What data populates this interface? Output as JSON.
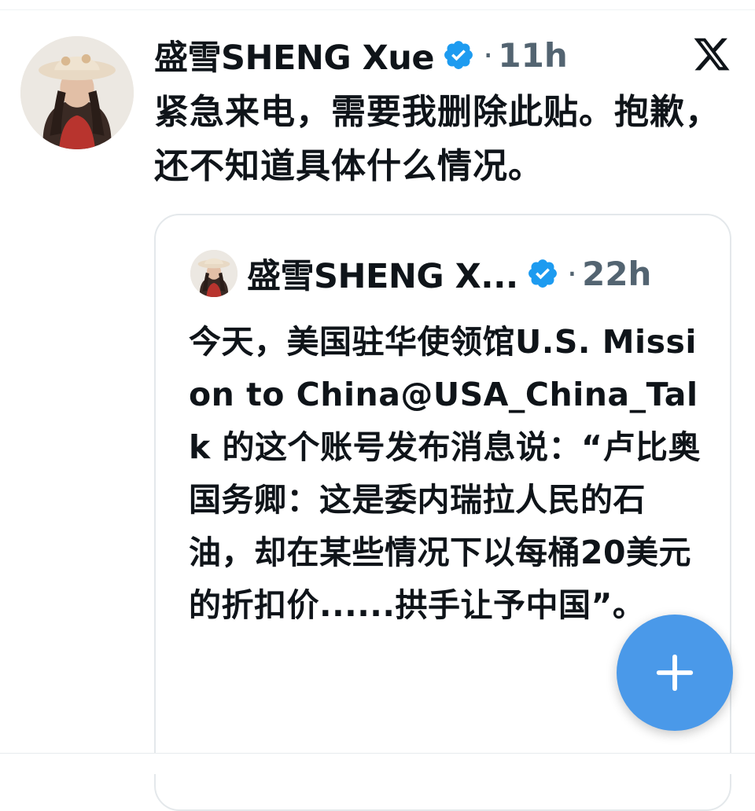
{
  "post": {
    "display_name": "盛雪SHENG Xue",
    "time_separator": "·",
    "timestamp": "11h",
    "text": "紧急来电，需要我删除此贴。抱歉，还不知道具体什么情况。"
  },
  "quoted_post": {
    "display_name": "盛雪SHENG X...",
    "time_separator": "·",
    "timestamp": "22h",
    "text": "今天，美国驻华使领馆U.S. Mission to China@USA_China_Talk 的这个账号发布消息说：“卢比奥国务卿：这是委内瑞拉人民的石油，却在某些情况下以每桶20美元的折扣价......拱手让予中国”。"
  },
  "icons": {
    "verified": "verified-badge-icon",
    "brand": "x-logo-icon",
    "compose": "plus-icon"
  },
  "colors": {
    "verified": "#1d9bf0",
    "fab": "#4a99e9",
    "secondary_text": "#536471"
  }
}
